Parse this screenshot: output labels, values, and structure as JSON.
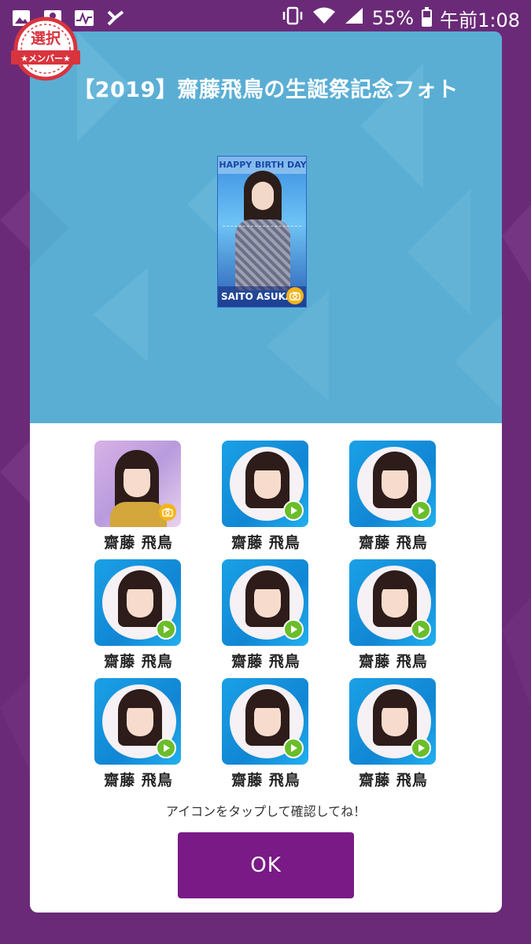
{
  "status_bar": {
    "battery": "55%",
    "battery_level": 0.55,
    "time": "午前1:08",
    "left_icons": [
      "image-icon",
      "contacts-icon",
      "activity-icon",
      "check-app-icon"
    ],
    "right_icons": [
      "vibrate-icon",
      "wifi-icon",
      "signal-icon",
      "battery-icon"
    ]
  },
  "badge": {
    "label": "選択",
    "sub": "★メンバー★"
  },
  "dialog": {
    "title": "【2019】齋藤飛鳥の生誕祭記念フォト",
    "photo": {
      "header": "HAPPY BIRTH DAY",
      "footer": "SAITO ASUKA 8"
    },
    "items": [
      {
        "name": "齋藤 飛鳥",
        "type": "photo"
      },
      {
        "name": "齋藤 飛鳥",
        "type": "video"
      },
      {
        "name": "齋藤 飛鳥",
        "type": "video"
      },
      {
        "name": "齋藤 飛鳥",
        "type": "video"
      },
      {
        "name": "齋藤 飛鳥",
        "type": "video"
      },
      {
        "name": "齋藤 飛鳥",
        "type": "video"
      },
      {
        "name": "齋藤 飛鳥",
        "type": "video"
      },
      {
        "name": "齋藤 飛鳥",
        "type": "video"
      },
      {
        "name": "齋藤 飛鳥",
        "type": "video"
      }
    ],
    "hint": "アイコンをタップして確認してね！",
    "ok_label": "OK"
  },
  "colors": {
    "background": "#6a2a78",
    "dialog_top": "#5aaed4",
    "ok_button": "#7a1a86",
    "play_icon": "#6bbd2a",
    "camera_badge": "#f3b51b"
  }
}
